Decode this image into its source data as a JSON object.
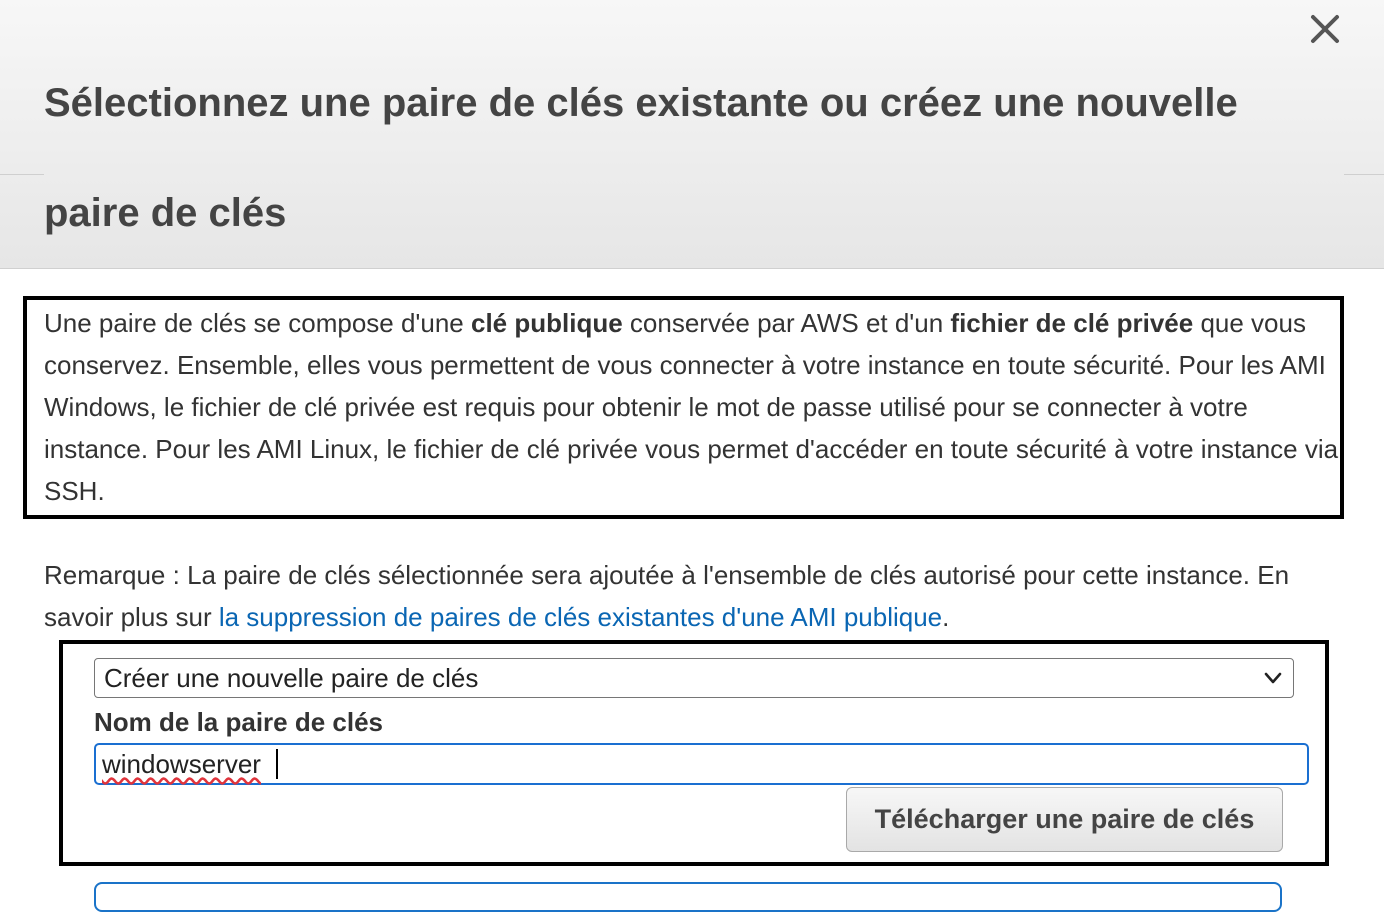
{
  "modal": {
    "title": "Sélectionnez une paire de clés existante ou créez une nouvelle paire de clés",
    "close_icon": "close-icon"
  },
  "info": {
    "part1": "Une paire de clés se compose d'une ",
    "bold1": "clé publique",
    "part2": " conservée par AWS et d'un ",
    "bold2": "fichier de clé privée",
    "part3": " que vous conservez. Ensemble, elles vous permettent de vous connecter à votre instance en toute sécurité. Pour les AMI Windows, le fichier de clé privée est requis pour obtenir le mot de passe utilisé pour se connecter à votre instance. Pour les AMI Linux, le fichier de clé privée vous permet d'accéder en toute sécurité à votre instance via SSH."
  },
  "note": {
    "text": "Remarque : La paire de clés sélectionnée sera ajoutée à l'ensemble de clés autorisé pour cette instance. En savoir plus sur ",
    "link": "la suppression de paires de clés existantes d'une AMI publique",
    "end": "."
  },
  "form": {
    "select_value": "Créer une nouvelle paire de clés",
    "key_name_label": "Nom de la paire de clés",
    "key_name_value": "windowserver",
    "download_button": "Télécharger une paire de clés"
  },
  "colors": {
    "link": "#0a66b3",
    "focus_border": "#1a6fd1",
    "header_bg": "#eeeeee"
  }
}
